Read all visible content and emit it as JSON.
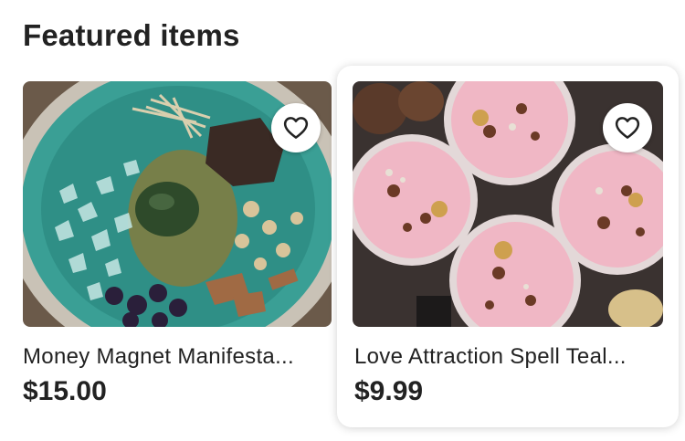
{
  "section": {
    "title": "Featured items"
  },
  "items": [
    {
      "title": "Money Magnet Manifestation Spell Bowl",
      "display_title": "Money Magnet Manifesta...",
      "price": "$15.00",
      "image_icon": "spell-bowl-photo",
      "favorite_icon": "heart-outline-icon"
    },
    {
      "title": "Love Attraction Spell Tealight Candles",
      "display_title": "Love Attraction Spell Teal...",
      "price": "$9.99",
      "image_icon": "tealight-candles-photo",
      "favorite_icon": "heart-outline-icon"
    }
  ],
  "colors": {
    "text": "#222222",
    "background": "#ffffff",
    "teal": "#3fa79a",
    "pink": "#f2b6c6"
  }
}
